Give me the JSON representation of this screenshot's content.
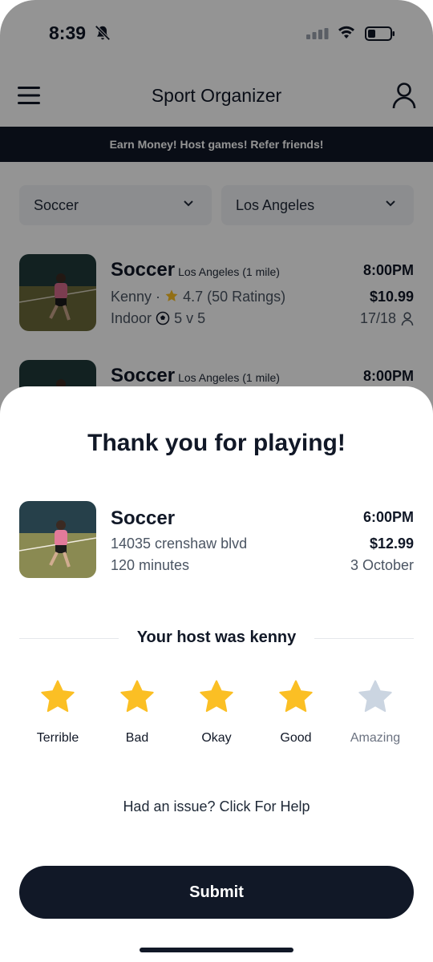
{
  "status_bar": {
    "time": "8:39"
  },
  "header": {
    "title": "Sport Organizer"
  },
  "promo_banner": {
    "text": "Earn Money!  Host games!  Refer friends!"
  },
  "filters": {
    "sport": "Soccer",
    "city": "Los Angeles"
  },
  "games": [
    {
      "title": "Soccer",
      "location": "Los Angeles (1 mile)",
      "host": "Kenny",
      "rating": "4.7 (50 Ratings)",
      "venue": "Indoor",
      "format": "5 v 5",
      "time": "8:00PM",
      "price": "$10.99",
      "spots": "17/18"
    },
    {
      "title": "Soccer",
      "location": "Los Angeles (1 mile)",
      "time": "8:00PM"
    }
  ],
  "modal": {
    "title": "Thank you for playing!",
    "booking": {
      "title": "Soccer",
      "address": "14035 crenshaw blvd",
      "duration": "120 minutes",
      "time": "6:00PM",
      "price": "$12.99",
      "date": "3 October"
    },
    "host_prompt": "Your host was kenny",
    "rating_options": [
      {
        "label": "Terrible",
        "selected": true
      },
      {
        "label": "Bad",
        "selected": true
      },
      {
        "label": "Okay",
        "selected": true
      },
      {
        "label": "Good",
        "selected": true
      },
      {
        "label": "Amazing",
        "selected": false
      }
    ],
    "selected_rating": 4,
    "help_text": "Had an issue? Click For Help",
    "submit_label": "Submit"
  },
  "colors": {
    "primary_dark": "#111827",
    "star_filled": "#FBBF24",
    "star_empty": "#CBD5E1"
  }
}
